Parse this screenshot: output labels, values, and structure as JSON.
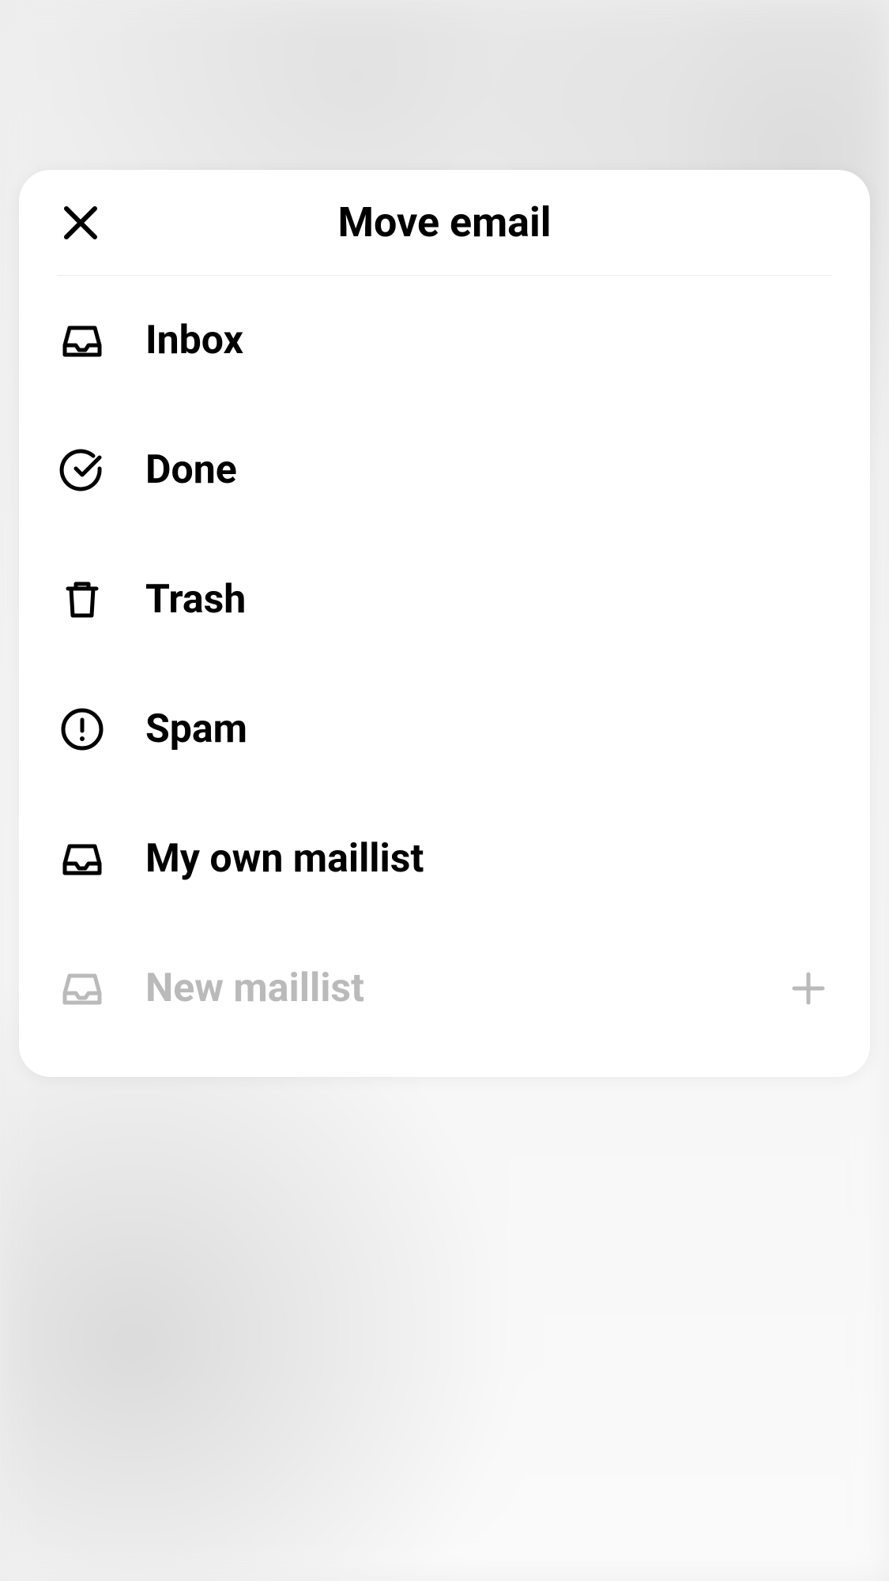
{
  "modal": {
    "title": "Move email",
    "items": [
      {
        "label": "Inbox"
      },
      {
        "label": "Done"
      },
      {
        "label": "Trash"
      },
      {
        "label": "Spam"
      },
      {
        "label": "My own maillist"
      }
    ],
    "newMaillist": {
      "label": "New maillist"
    }
  }
}
